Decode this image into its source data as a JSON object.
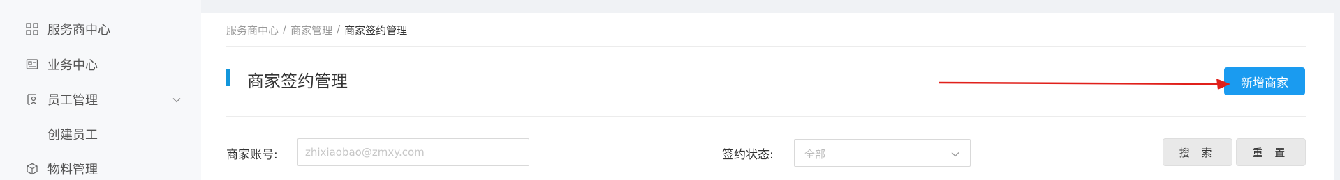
{
  "sidebar": {
    "items": [
      {
        "label": "服务商中心",
        "icon": "grid-icon"
      },
      {
        "label": "业务中心",
        "icon": "business-icon"
      },
      {
        "label": "员工管理",
        "icon": "staff-icon"
      },
      {
        "label": "创建员工"
      },
      {
        "label": "物料管理",
        "icon": "box-icon"
      }
    ]
  },
  "breadcrumb": {
    "items": [
      "服务商中心",
      "商家管理",
      "商家签约管理"
    ],
    "separator": "/"
  },
  "page": {
    "title": "商家签约管理",
    "add_button": "新增商家"
  },
  "filters": {
    "account_label": "商家账号:",
    "account_placeholder": "zhixiaobao@zmxy.com",
    "status_label": "签约状态:",
    "status_value": "全部",
    "search_button": "搜 索",
    "reset_button": "重 置"
  },
  "colors": {
    "accent": "#1a9bf0",
    "title_bar": "#1296db",
    "annotation_arrow": "#e0201b"
  }
}
